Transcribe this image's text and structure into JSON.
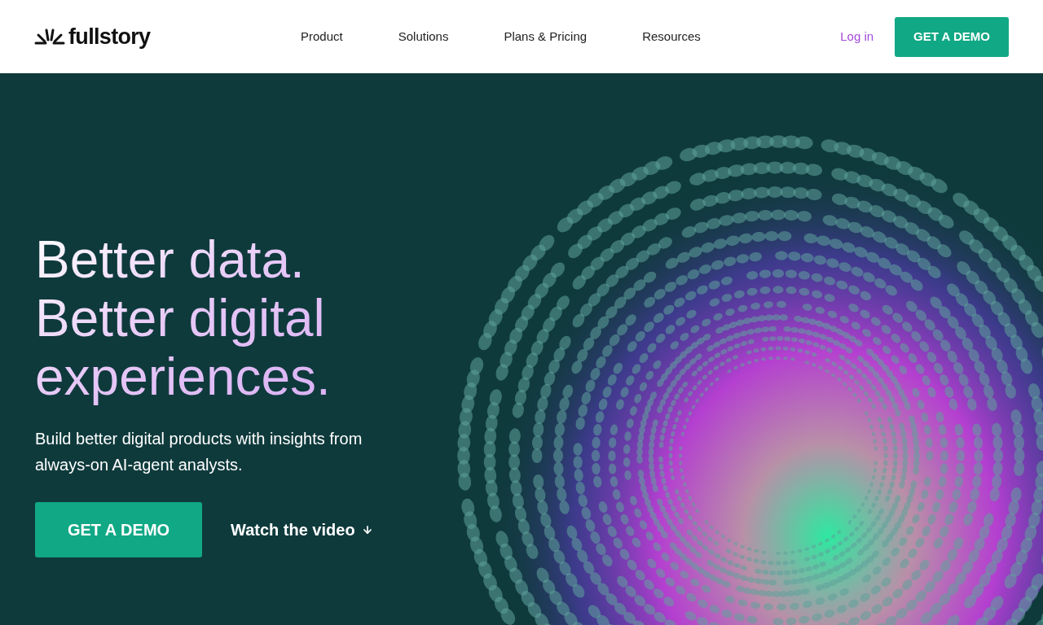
{
  "logo": {
    "text": "fullstory"
  },
  "nav": {
    "items": [
      "Product",
      "Solutions",
      "Plans & Pricing",
      "Resources"
    ],
    "login": "Log in",
    "cta": "GET A DEMO"
  },
  "hero": {
    "headline_lines": [
      "Better data.",
      "Better digital",
      "experiences."
    ],
    "subtitle": "Build better digital products with insights from always-on AI-agent analysts.",
    "cta": "GET A DEMO",
    "video_link": "Watch the video"
  }
}
